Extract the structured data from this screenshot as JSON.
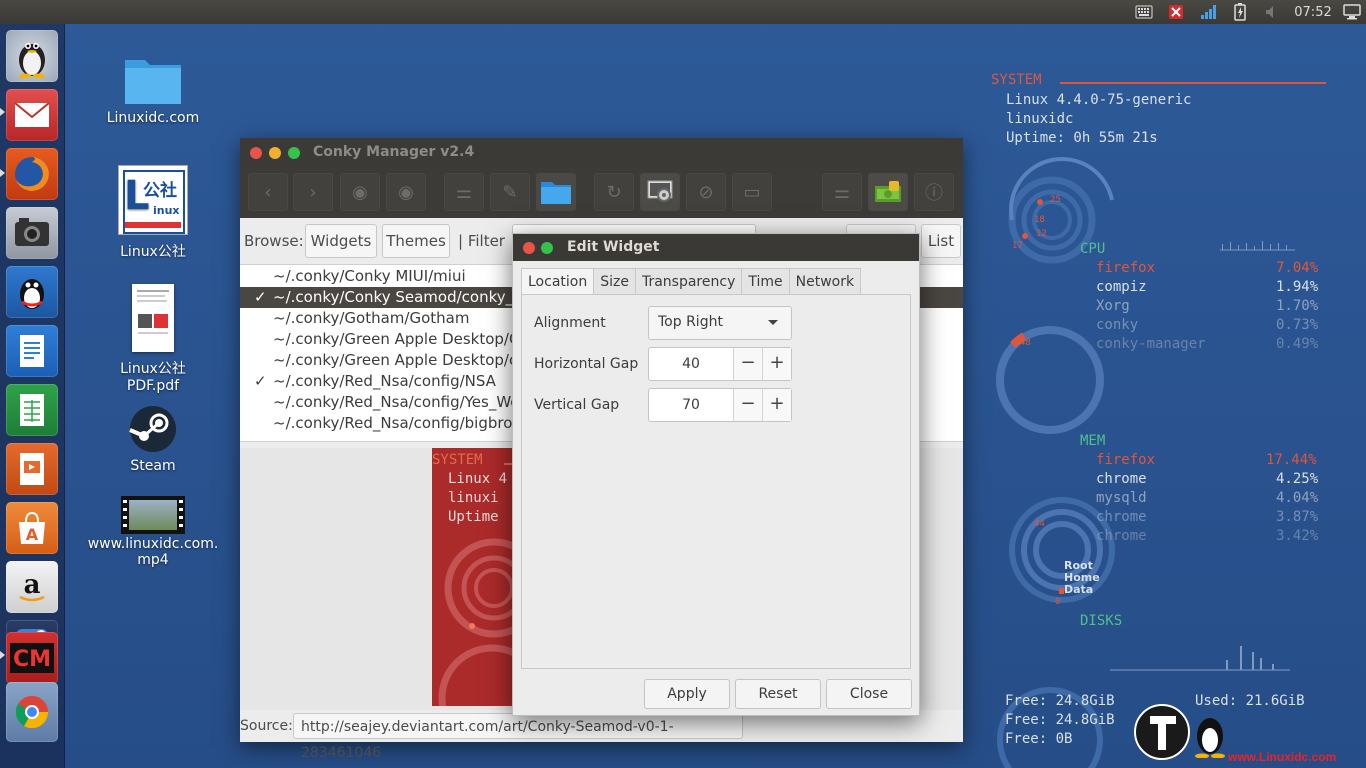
{
  "top_panel": {
    "clock": "07:52"
  },
  "desktop": {
    "icons": [
      {
        "label": "Linuxidc.com"
      },
      {
        "label": "Linux公社",
        "logo_text": "公社"
      },
      {
        "label": "Linux公社PDF.pdf"
      },
      {
        "label": "Steam"
      },
      {
        "label_line1": "www.linuxidc.com.",
        "label_line2": "mp4"
      }
    ]
  },
  "conky": {
    "system_header": "SYSTEM",
    "kernel": "Linux 4.4.0-75-generic",
    "hostname": "linuxidc",
    "uptime": "Uptime: 0h 55m 21s",
    "cpu_header": "CPU",
    "cpu_procs": [
      {
        "name": "firefox",
        "value": "7.04%"
      },
      {
        "name": "compiz",
        "value": "1.94%"
      },
      {
        "name": "Xorg",
        "value": "1.70%"
      },
      {
        "name": "conky",
        "value": "0.73%"
      },
      {
        "name": "conky-manager",
        "value": "0.49%"
      }
    ],
    "mem_header": "MEM",
    "mem_procs": [
      {
        "name": "firefox",
        "value": "17.44%"
      },
      {
        "name": "chrome",
        "value": "4.25%"
      },
      {
        "name": "mysqld",
        "value": "4.04%"
      },
      {
        "name": "chrome",
        "value": "3.87%"
      },
      {
        "name": "chrome",
        "value": "3.42%"
      }
    ],
    "disk_labels": [
      "Root",
      "Home",
      "Data"
    ],
    "disks_header": "DISKS",
    "free1": "Free: 24.8GiB",
    "used1": "Used: 21.6GiB",
    "free2": "Free: 24.8GiB",
    "free3": "Free: 0B",
    "ring_labels": {
      "r25": "25",
      "r18": "18",
      "r12": "12",
      "r17": "17",
      "r48": "48",
      "r44": "44",
      "r0": "0"
    },
    "watermark_text": "www.Linuxidc.com"
  },
  "conky_manager": {
    "title": "Conky Manager v2.4",
    "browse_label": "Browse:",
    "widgets_btn": "Widgets",
    "themes_btn": "Themes",
    "filter_label": "| Filter",
    "list_btn": "List",
    "rows": [
      {
        "check": "",
        "path": "~/.conky/Conky MIUI/miui"
      },
      {
        "check": "✓",
        "path": "~/.conky/Conky Seamod/conky_sea"
      },
      {
        "check": "",
        "path": "~/.conky/Gotham/Gotham"
      },
      {
        "check": "",
        "path": "~/.conky/Green Apple Desktop/Got"
      },
      {
        "check": "",
        "path": "~/.conky/Green Apple Desktop/con"
      },
      {
        "check": "✓",
        "path": "~/.conky/Red_Nsa/config/NSA"
      },
      {
        "check": "",
        "path": "~/.conky/Red_Nsa/config/Yes_We_"
      },
      {
        "check": "",
        "path": "~/.conky/Red_Nsa/config/bigbroth"
      }
    ],
    "preview": {
      "system": "SYSTEM",
      "line1": "Linux 4",
      "line2": "linuxi",
      "line3": "Uptime"
    },
    "source_label": "Source:",
    "source_url": "http://seajey.deviantart.com/art/Conky-Seamod-v0-1-283461046"
  },
  "edit_widget": {
    "title": "Edit Widget",
    "tabs": [
      "Location",
      "Size",
      "Transparency",
      "Time",
      "Network"
    ],
    "alignment_label": "Alignment",
    "alignment_value": "Top Right",
    "hgap_label": "Horizontal Gap",
    "hgap_value": "40",
    "vgap_label": "Vertical Gap",
    "vgap_value": "70",
    "minus": "−",
    "plus": "+",
    "apply": "Apply",
    "reset": "Reset",
    "close": "Close"
  }
}
